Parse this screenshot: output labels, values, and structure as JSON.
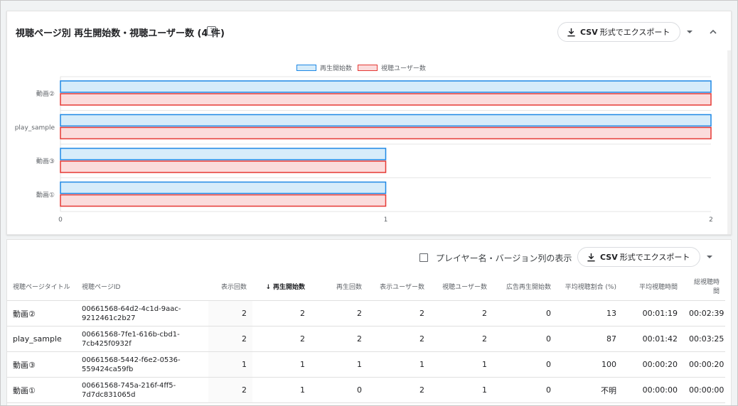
{
  "chart_card": {
    "title": "視聴ページ別 再生開始数・視聴ユーザー数 (4 件)",
    "help_icon_glyph": "?",
    "export": {
      "bold": "CSV",
      "label": "形式でエクスポート"
    }
  },
  "chart_data": {
    "type": "bar",
    "orientation": "horizontal",
    "categories": [
      "動画②",
      "play_sample",
      "動画③",
      "動画①"
    ],
    "series": [
      {
        "name": "再生開始数",
        "values": [
          2,
          2,
          1,
          1
        ],
        "color": "#1e88e5",
        "fill": "#d6ecfa"
      },
      {
        "name": "視聴ユーザー数",
        "values": [
          2,
          2,
          1,
          1
        ],
        "color": "#e53935",
        "fill": "#fbdcdc"
      }
    ],
    "xlim": [
      0,
      2
    ],
    "xticks": [
      "0",
      "1",
      "2"
    ],
    "legend": "top-center",
    "grid": true
  },
  "table_card": {
    "checkbox_label": "プレイヤー名・バージョン列の表示",
    "export": {
      "bold": "CSV",
      "label": "形式でエクスポート"
    },
    "columns": [
      {
        "label": "視聴ページタイトル",
        "align": "l"
      },
      {
        "label": "視聴ページID",
        "align": "l"
      },
      {
        "label": "表示回数",
        "align": "r"
      },
      {
        "label": "再生開始数",
        "align": "r",
        "sorted": true,
        "arrow": "↓"
      },
      {
        "label": "再生回数",
        "align": "r"
      },
      {
        "label": "表示ユーザー数",
        "align": "r"
      },
      {
        "label": "視聴ユーザー数",
        "align": "r"
      },
      {
        "label": "広告再生開始数",
        "align": "r"
      },
      {
        "label": "平均視聴割合 (%)",
        "align": "r"
      },
      {
        "label": "平均視聴時間",
        "align": "r"
      },
      {
        "label": "総視聴時間",
        "align": "r"
      }
    ],
    "rows": [
      [
        "動画②",
        "00661568-64d2-4c1d-9aac-9212461c2b27",
        "2",
        "2",
        "2",
        "2",
        "2",
        "0",
        "13",
        "00:01:19",
        "00:02:39"
      ],
      [
        "play_sample",
        "00661568-7fe1-616b-cbd1-7cb425f0932f",
        "2",
        "2",
        "2",
        "2",
        "2",
        "0",
        "87",
        "00:01:42",
        "00:03:25"
      ],
      [
        "動画③",
        "00661568-5442-f6e2-0536-559424ca59fb",
        "1",
        "1",
        "1",
        "1",
        "1",
        "0",
        "100",
        "00:00:20",
        "00:00:20"
      ],
      [
        "動画①",
        "00661568-745a-216f-4ff5-7d7dc831065d",
        "2",
        "1",
        "0",
        "2",
        "1",
        "0",
        "不明",
        "00:00:00",
        "00:00:00"
      ]
    ]
  }
}
